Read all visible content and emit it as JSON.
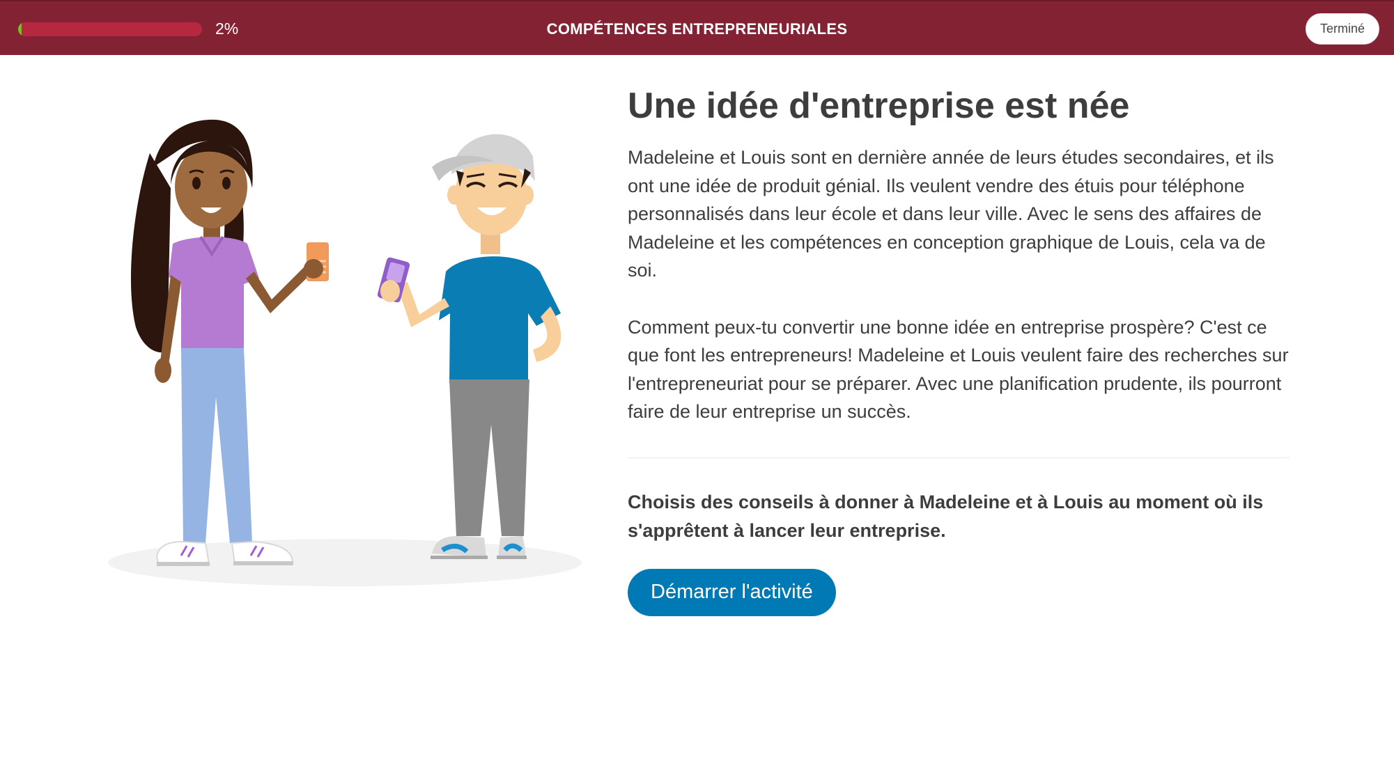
{
  "header": {
    "progress_label": "2%",
    "progress_fraction": 0.02,
    "title": "COMPÉTENCES ENTREPRENEURIALES",
    "done_label": "Terminé"
  },
  "main": {
    "heading": "Une idée d'entreprise est née",
    "paragraphs": [
      "Madeleine et Louis sont en dernière année de leurs études secondaires, et ils ont une idée de produit génial. Ils veulent vendre des étuis pour téléphone personnalisés dans leur école et dans leur ville. Avec le sens des affaires de Madeleine et les compétences en conception graphique de Louis, cela va de soi.",
      "Comment peux-tu convertir une bonne idée en entreprise prospère? C'est ce que font les entrepreneurs! Madeleine et Louis veulent faire des recherches sur l'entrepreneuriat pour se préparer. Avec une planification prudente, ils pourront faire de leur entreprise un succès."
    ],
    "prompt": "Choisis des conseils à donner à Madeleine et à Louis au moment où ils s'apprêtent à lancer leur entreprise.",
    "start_label": "Démarrer l'activité"
  },
  "colors": {
    "header_bg": "#822233",
    "progress_track": "#b5283f",
    "progress_fill": "#7dbb2a",
    "button_blue": "#0079b4",
    "text": "#3d3d3d"
  },
  "illustration": {
    "characters": [
      "woman-with-orange-phone",
      "man-in-cap-with-purple-phone"
    ]
  }
}
